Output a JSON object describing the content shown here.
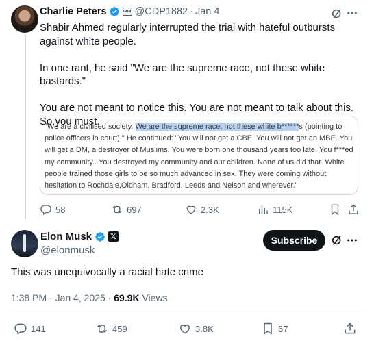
{
  "parent_tweet": {
    "author_name": "Charlie Peters",
    "affiliation_badge": "GBN",
    "handle": "@CDP1882",
    "date": "Jan 4",
    "body": "Shabir Ahmed regularly interrupted the trial with hateful outbursts against white people.\n\nIn one rant, he said \"We are the supreme race, not these white bastards.\"\n\nYou are not meant to notice this. You are not meant to talk about this. So you must.",
    "quote_before": "\"We are a civilised society. ",
    "quote_highlight": "We are the supreme race, not these white b******",
    "quote_after": "s (pointing to police officers in court).\" He continued: \"You will not get a CBE. You will not get an MBE. You will get a DM, a destroyer of Muslims. You were born one thousand years too late. You f***ed my community.. You destroyed my community and our children. None of us did that. White people trained those girls to be so much advanced in sex. They were coming without hesitation to Rochdale,Oldham, Bradford, Leeds and Nelson and wherever.\"",
    "stats": {
      "replies": "58",
      "reposts": "697",
      "likes": "2.3K",
      "views": "115K"
    }
  },
  "main_tweet": {
    "author_name": "Elon Musk",
    "handle": "@elonmusk",
    "subscribe_label": "Subscribe",
    "body": "This was unequivocally a racial hate crime",
    "time": "1:38 PM",
    "date": "Jan 4, 2025",
    "views_count": "69.9K",
    "views_label": "Views",
    "stats": {
      "replies": "141",
      "reposts": "459",
      "likes": "3.8K",
      "bookmarks": "67"
    }
  },
  "colors": {
    "accent_blue": "#1d9bf0",
    "text_primary": "#0f1419",
    "text_secondary": "#536471",
    "highlight": "#b7d1f2"
  },
  "icons": [
    "verified-icon",
    "grok-icon",
    "more-icon",
    "reply-icon",
    "repost-icon",
    "like-icon",
    "views-icon",
    "bookmark-icon",
    "share-icon"
  ]
}
